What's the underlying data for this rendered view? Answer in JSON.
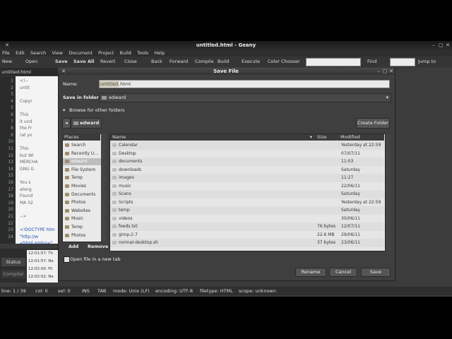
{
  "window": {
    "title": "untitled.html - Geany"
  },
  "menu": [
    "File",
    "Edit",
    "Search",
    "View",
    "Document",
    "Project",
    "Build",
    "Tools",
    "Help"
  ],
  "toolbar": {
    "new": "New",
    "open": "Open",
    "save": "Save",
    "save_all": "Save All",
    "revert": "Revert",
    "close": "Close",
    "back": "Back",
    "forward": "Forward",
    "compile": "Compile",
    "build": "Build",
    "execute": "Execute",
    "color_chooser": "Color Chooser",
    "find": "Find",
    "jump_to": "Jump to"
  },
  "editor": {
    "tab": "untitled.html",
    "line_numbers": [
      "1",
      "2",
      "3",
      "4",
      "5",
      "6",
      "7",
      "8",
      "9",
      "10",
      "11",
      "12",
      "13",
      "14",
      "15",
      "16",
      "17",
      "18",
      "19",
      "20",
      "21",
      "22",
      "23",
      "24"
    ],
    "lines": [
      "<!--",
      "untit",
      "",
      "Copyr",
      "",
      "This",
      "it und",
      "the Fr",
      "(at yo",
      "",
      "This",
      "but WI",
      "MERCHA",
      "GNU G",
      "",
      "You s",
      "along",
      "Found",
      "MA 02",
      "",
      "-->",
      "",
      "<!DOCTYPE htm",
      "\"http://w"
    ],
    "last_line": "<html xmlns=\""
  },
  "messages": {
    "tabs": [
      "Status",
      "Compiler"
    ],
    "log": [
      "12:01:57: Th",
      "12:01:57: Ne",
      "12:02:00: Fil",
      "12:02:02: Ne"
    ]
  },
  "statusbar": {
    "line": "line: 1 / 39",
    "col": "col: 0",
    "sel": "sel: 0",
    "ins": "INS",
    "tab": "TAB",
    "mode": "mode: Unix (LF)",
    "encoding": "encoding: UTF-8",
    "filetype": "filetype: HTML",
    "scope": "scope: unknown"
  },
  "dialog": {
    "title": "Save File",
    "name_label": "Name:",
    "name_selected": "untitled",
    "name_ext": ".html",
    "folder_label": "Save in folder:",
    "folder_value": "edward",
    "browse_label": "Browse for other folders",
    "path_button": "edward",
    "create_folder": "Create Folder",
    "places_header": "Places",
    "places": [
      "Search",
      "Recently U...",
      "edward",
      "File System",
      "Temp",
      "Movies",
      "Documents",
      "Photos",
      "Websites",
      "Music",
      "Temp",
      "Photos"
    ],
    "add": "Add",
    "remove": "Remove",
    "columns": {
      "name": "Name",
      "size": "Size",
      "modified": "Modified"
    },
    "files": [
      {
        "name": "Calendar",
        "size": "",
        "modified": "Yesterday at 22:59"
      },
      {
        "name": "Desktop",
        "size": "",
        "modified": "07/07/11"
      },
      {
        "name": "documents",
        "size": "",
        "modified": "11:03"
      },
      {
        "name": "downloads",
        "size": "",
        "modified": "Saturday"
      },
      {
        "name": "images",
        "size": "",
        "modified": "11:27"
      },
      {
        "name": "music",
        "size": "",
        "modified": "22/06/11"
      },
      {
        "name": "Scans",
        "size": "",
        "modified": "Saturday"
      },
      {
        "name": "Scripts",
        "size": "",
        "modified": "Yesterday at 22:59"
      },
      {
        "name": "temp",
        "size": "",
        "modified": "Saturday"
      },
      {
        "name": "videos",
        "size": "",
        "modified": "30/06/11"
      },
      {
        "name": "feeds.txt",
        "size": "76 bytes",
        "modified": "12/07/11"
      },
      {
        "name": "gimp-2.7",
        "size": "22.6 MB",
        "modified": "29/06/11"
      },
      {
        "name": "normal-desktop.sh",
        "size": "37 bytes",
        "modified": "23/06/11"
      }
    ],
    "open_new_tab": "Open file in a new tab",
    "rename": "Rename",
    "cancel": "Cancel",
    "save": "Save"
  },
  "colors": {
    "accent": "#8fb33a",
    "selection": "#c9c5ae"
  }
}
